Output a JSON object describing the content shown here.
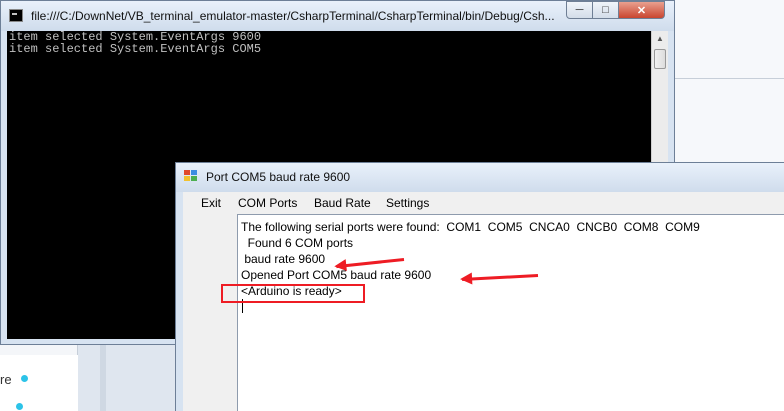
{
  "colors": {
    "highlight": "#ee1c24",
    "console_bg": "#000000",
    "console_text": "#c0c0c0"
  },
  "background": {
    "fragment_text": "re"
  },
  "console_window": {
    "title": "file:///C:/DownNet/VB_terminal_emulator-master/CsharpTerminal/CsharpTerminal/bin/Debug/Csh...",
    "buttons": {
      "minimize": "─",
      "maximize": "□",
      "close": "✕"
    },
    "lines": [
      "item selected System.EventArgs 9600",
      "item selected System.EventArgs COM5"
    ],
    "scroll_up": "▲"
  },
  "port_window": {
    "title": "Port COM5 baud rate 9600",
    "menu": [
      "Exit",
      "COM Ports",
      "Baud Rate",
      "Settings"
    ],
    "log_lines": [
      "The following serial ports were found:  COM1  COM5  CNCA0  CNCB0  COM8  COM9",
      "  Found 6 COM ports",
      " baud rate 9600",
      "Opened Port COM5 baud rate 9600",
      "<Arduino is ready>"
    ]
  }
}
